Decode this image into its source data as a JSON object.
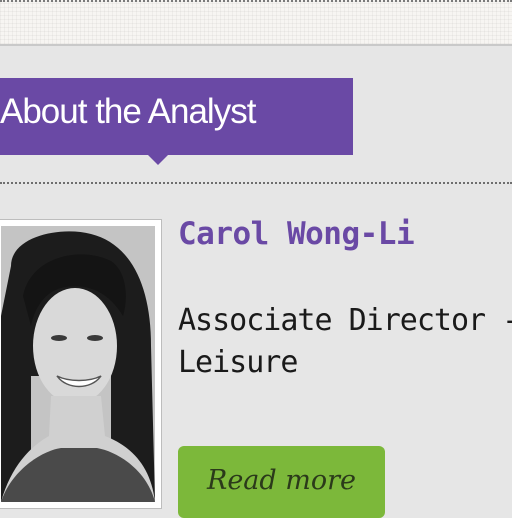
{
  "section": {
    "title": "About the Analyst"
  },
  "analyst": {
    "name": "Carol Wong-Li",
    "role_line1": "Associate Director -",
    "role_line2": "Leisure",
    "read_more_label": "Read more"
  },
  "colors": {
    "accent": "#6a49a5",
    "button": "#7cb83a",
    "panel": "#e6e6e6"
  }
}
